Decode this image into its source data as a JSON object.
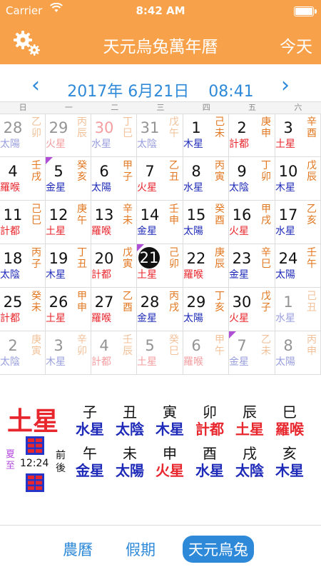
{
  "status": {
    "carrier": "Carrier",
    "time": "8:42 AM"
  },
  "nav": {
    "title": "天元烏兔萬年曆",
    "today": "今天"
  },
  "datebar": {
    "date": "2017年 6月21日",
    "time": "08:41"
  },
  "weekdays": [
    "日",
    "一",
    "二",
    "三",
    "四",
    "五",
    "六"
  ],
  "colors": {
    "orange": "#f7a24a",
    "blue": "#2e8ad8",
    "red": "#e8262d",
    "purple": "#b04ed6"
  },
  "grid": [
    [
      {
        "num": "28",
        "p": "太陽",
        "gz": "乙卯",
        "dim": true
      },
      {
        "num": "29",
        "p": "火星",
        "gz": "丙辰",
        "dim": true
      },
      {
        "num": "30",
        "p": "水星",
        "gz": "丁巳",
        "dim": true,
        "numColor": "#e8262d"
      },
      {
        "num": "31",
        "p": "太陰",
        "gz": "戊午",
        "dim": true
      },
      {
        "num": "1",
        "p": "木星",
        "gz": "己未"
      },
      {
        "num": "2",
        "p": "計都",
        "gz": "庚申"
      },
      {
        "num": "3",
        "p": "土星",
        "gz": "辛酉"
      }
    ],
    [
      {
        "num": "4",
        "p": "羅喉",
        "gz": "壬戌"
      },
      {
        "num": "5",
        "p": "金星",
        "gz": "癸亥",
        "tri": true
      },
      {
        "num": "6",
        "p": "太陽",
        "gz": "甲子"
      },
      {
        "num": "7",
        "p": "火星",
        "gz": "乙丑"
      },
      {
        "num": "8",
        "p": "水星",
        "gz": "丙寅"
      },
      {
        "num": "9",
        "p": "太陰",
        "gz": "丁卯"
      },
      {
        "num": "10",
        "p": "木星",
        "gz": "戊辰"
      }
    ],
    [
      {
        "num": "11",
        "p": "計都",
        "gz": "己巳"
      },
      {
        "num": "12",
        "p": "土星",
        "gz": "庚午"
      },
      {
        "num": "13",
        "p": "羅喉",
        "gz": "辛未"
      },
      {
        "num": "14",
        "p": "金星",
        "gz": "壬申"
      },
      {
        "num": "15",
        "p": "太陽",
        "gz": "癸酉"
      },
      {
        "num": "16",
        "p": "火星",
        "gz": "甲戌"
      },
      {
        "num": "17",
        "p": "水星",
        "gz": "乙亥"
      }
    ],
    [
      {
        "num": "18",
        "p": "太陰",
        "gz": "丙子"
      },
      {
        "num": "19",
        "p": "木星",
        "gz": "丁丑"
      },
      {
        "num": "20",
        "p": "計都",
        "gz": "戊寅"
      },
      {
        "num": "21",
        "p": "土星",
        "gz": "己卯",
        "today": true,
        "tri": true
      },
      {
        "num": "22",
        "p": "羅喉",
        "gz": "庚辰"
      },
      {
        "num": "23",
        "p": "金星",
        "gz": "辛巳"
      },
      {
        "num": "24",
        "p": "太陽",
        "gz": "壬午"
      }
    ],
    [
      {
        "num": "25",
        "p": "計都",
        "gz": "癸未"
      },
      {
        "num": "26",
        "p": "土星",
        "gz": "甲申"
      },
      {
        "num": "27",
        "p": "羅喉",
        "gz": "乙酉"
      },
      {
        "num": "28",
        "p": "金星",
        "gz": "丙戌"
      },
      {
        "num": "29",
        "p": "太陽",
        "gz": "丁亥"
      },
      {
        "num": "30",
        "p": "火星",
        "gz": "戊子"
      },
      {
        "num": "1",
        "p": "水星",
        "gz": "己丑",
        "dim": true
      }
    ],
    [
      {
        "num": "2",
        "p": "太陰",
        "gz": "庚寅",
        "dim": true
      },
      {
        "num": "3",
        "p": "木星",
        "gz": "辛卯",
        "dim": true
      },
      {
        "num": "4",
        "p": "計都",
        "gz": "壬辰",
        "dim": true
      },
      {
        "num": "5",
        "p": "土星",
        "gz": "癸巳",
        "dim": true
      },
      {
        "num": "6",
        "p": "羅喉",
        "gz": "甲午",
        "dim": true
      },
      {
        "num": "7",
        "p": "金星",
        "gz": "乙未",
        "dim": true,
        "tri": true
      },
      {
        "num": "8",
        "p": "太陽",
        "gz": "丙申",
        "dim": true
      }
    ]
  ],
  "planetColors": {
    "太陽": "#1f2bb8",
    "火星": "#e8262d",
    "水星": "#1f2bb8",
    "太陰": "#1f2bb8",
    "木星": "#1f2bb8",
    "計都": "#e8262d",
    "土星": "#e8262d",
    "羅喉": "#e8262d",
    "金星": "#1f2bb8"
  },
  "panel": {
    "big": "土星",
    "season": "夏至",
    "time": "12:24",
    "qianhou": "前後",
    "hours": [
      [
        {
          "b": "子",
          "p": "水星"
        },
        {
          "b": "丑",
          "p": "太陰"
        },
        {
          "b": "寅",
          "p": "木星"
        },
        {
          "b": "卯",
          "p": "計都"
        },
        {
          "b": "辰",
          "p": "土星"
        },
        {
          "b": "巳",
          "p": "羅喉"
        }
      ],
      [
        {
          "b": "午",
          "p": "金星"
        },
        {
          "b": "未",
          "p": "太陽"
        },
        {
          "b": "申",
          "p": "火星"
        },
        {
          "b": "酉",
          "p": "水星"
        },
        {
          "b": "戌",
          "p": "太陰"
        },
        {
          "b": "亥",
          "p": "木星"
        }
      ]
    ]
  },
  "tabs": [
    {
      "label": "農曆",
      "active": false
    },
    {
      "label": "假期",
      "active": false
    },
    {
      "label": "天元烏兔",
      "active": true
    }
  ]
}
